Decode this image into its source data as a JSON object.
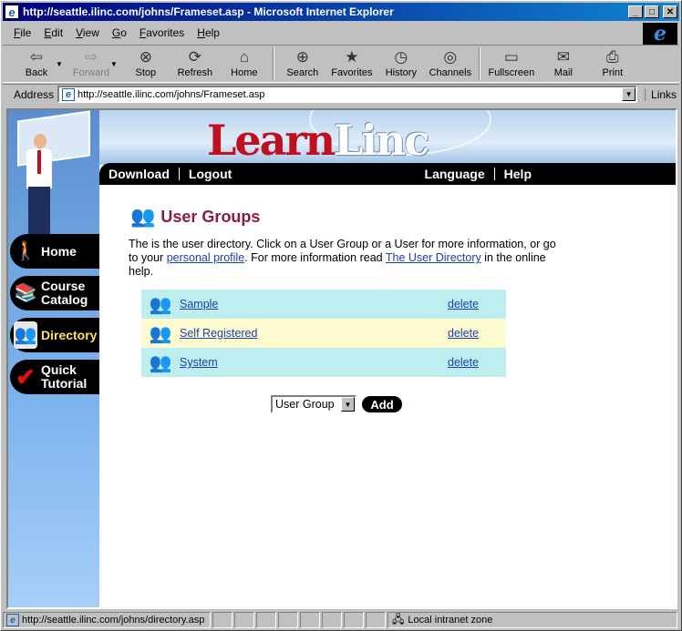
{
  "window": {
    "title": "http://seattle.ilinc.com/johns/Frameset.asp - Microsoft Internet Explorer"
  },
  "menu": {
    "items": [
      "File",
      "Edit",
      "View",
      "Go",
      "Favorites",
      "Help"
    ]
  },
  "toolbar": {
    "back": "Back",
    "forward": "Forward",
    "stop": "Stop",
    "refresh": "Refresh",
    "home": "Home",
    "search": "Search",
    "favorites": "Favorites",
    "history": "History",
    "channels": "Channels",
    "fullscreen": "Fullscreen",
    "mail": "Mail",
    "print": "Print"
  },
  "address": {
    "label": "Address",
    "url": "http://seattle.ilinc.com/johns/Frameset.asp",
    "links": "Links"
  },
  "banner": {
    "logo_learn": "Learn",
    "logo_linc": "Linc"
  },
  "topnav": {
    "download": "Download",
    "logout": "Logout",
    "language": "Language",
    "help": "Help"
  },
  "sidebar": {
    "home": "Home",
    "course_catalog_1": "Course",
    "course_catalog_2": "Catalog",
    "directory": "Directory",
    "quick_tutorial_1": "Quick",
    "quick_tutorial_2": "Tutorial"
  },
  "main": {
    "title": "User Groups",
    "intro_1": "The is the user directory. Click on a User Group or a User for more information, or go to your ",
    "intro_link_1": "personal profile",
    "intro_2": ". For more information read ",
    "intro_link_2": "The User Directory",
    "intro_3": " in the online help.",
    "groups": [
      {
        "name": "Sample",
        "action": "delete"
      },
      {
        "name": "Self Registered",
        "action": "delete"
      },
      {
        "name": "System",
        "action": "delete"
      }
    ],
    "select_value": "User Group",
    "add_label": "Add"
  },
  "status": {
    "url": "http://seattle.ilinc.com/johns/directory.asp",
    "zone": "Local intranet zone"
  }
}
